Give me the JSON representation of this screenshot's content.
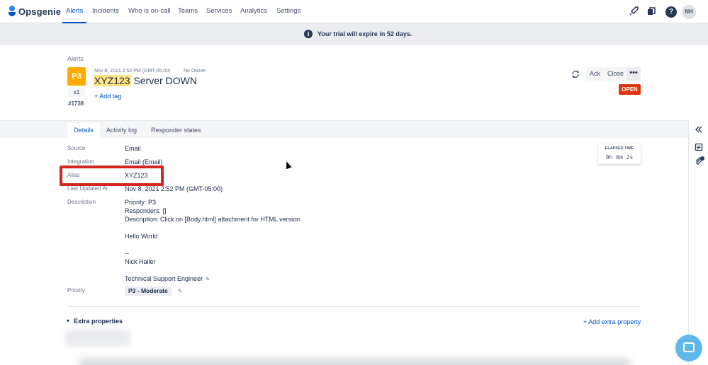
{
  "app": {
    "name": "Opsgenie"
  },
  "nav": {
    "items": [
      "Alerts",
      "Incidents",
      "Who is on-call",
      "Teams",
      "Services",
      "Analytics",
      "Settings"
    ],
    "active": "Alerts",
    "icons": [
      "rocket-icon",
      "marketplace-icon",
      "help-icon"
    ],
    "avatar_initials": "NH"
  },
  "banner": {
    "text": "Your trial will expire in 52 days."
  },
  "breadcrumb": "Alerts",
  "alert": {
    "priority": "P3",
    "count": "x1",
    "number": "#1738",
    "date": "Nov 8, 2021 2:52 PM (GMT-05:00)",
    "separator": "·",
    "owner": "No Owner",
    "title_highlight": "XYZ123",
    "title_rest": " Server DOWN",
    "add_tag": "+ Add tag",
    "status": "OPEN"
  },
  "actions": {
    "ack": "Ack",
    "close": "Close",
    "more": "•••"
  },
  "tabs": [
    "Details",
    "Activity log",
    "Responder states"
  ],
  "details": {
    "source_label": "Source",
    "source_value": "Email",
    "integration_label": "Integration",
    "integration_value": "Email (Email)",
    "alias_label": "Alias",
    "alias_value": "XYZ123",
    "updated_label": "Last Updated At",
    "updated_value": "Nov 8, 2021 2:52 PM (GMT-05:00)",
    "description_label": "Description",
    "description_lines": [
      "Priority: P3",
      "Responders: []",
      "Description: Click on [Body.html] attachment for HTML version",
      "",
      "Hello World",
      "",
      "--",
      "Nick Haller",
      "",
      "Technical Support Engineer"
    ],
    "priority_label": "Priority",
    "priority_value": "P3 - Moderate"
  },
  "elapsed": {
    "label": "ELAPSED TIME",
    "value": "0h 0m 2s"
  },
  "extra": {
    "title": "Extra properties",
    "add": "+ Add extra property"
  },
  "colors": {
    "accent": "#0052CC",
    "priority": "#FFAB00",
    "status_open": "#DE350B",
    "highlight_box": "#D4251F"
  }
}
